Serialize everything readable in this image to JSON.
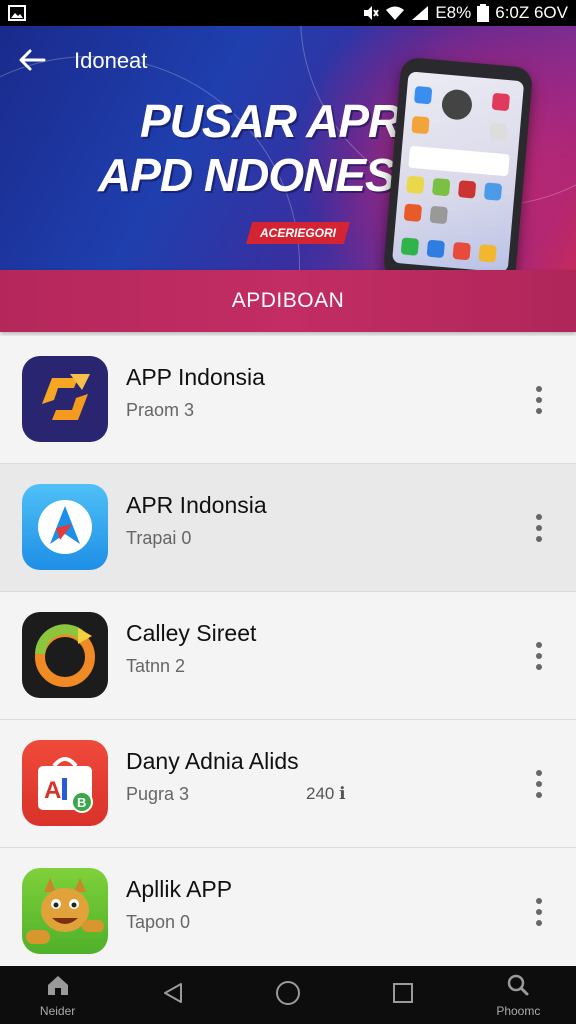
{
  "status_bar": {
    "battery_text": "E8%",
    "time_text": "6:0Z 6OV"
  },
  "banner": {
    "title": "Idoneat",
    "headline_line1": "PUSAR APR",
    "headline_line2": "APD NDONESIA",
    "badge": "ACERIEGORI"
  },
  "section": {
    "label": "APDIBOAN"
  },
  "apps": [
    {
      "name": "APP Indonsia",
      "subtitle": "Praom 3",
      "extra": ""
    },
    {
      "name": "APR Indonsia",
      "subtitle": "Trapai 0",
      "extra": ""
    },
    {
      "name": "Calley Sireet",
      "subtitle": "Tatnn 2",
      "extra": ""
    },
    {
      "name": "Dany Adnia Alids",
      "subtitle": "Pugra 3",
      "extra": "240 ℹ"
    },
    {
      "name": "Apllik APP",
      "subtitle": "Tapon 0",
      "extra": ""
    }
  ],
  "nav": {
    "home_label": "Neider",
    "phone_label": "Phoomc"
  },
  "colors": {
    "banner_start": "#1a2a8c",
    "banner_end": "#c62a5a",
    "section_bar": "#c22d63",
    "nav_bg": "#0d0d0d"
  },
  "icons": {
    "back": "arrow-left-icon",
    "nav": [
      "home-icon",
      "back-triangle-icon",
      "home-circle-icon",
      "recents-square-icon",
      "phone-search-icon"
    ],
    "row_action": "more-vertical-icon"
  }
}
